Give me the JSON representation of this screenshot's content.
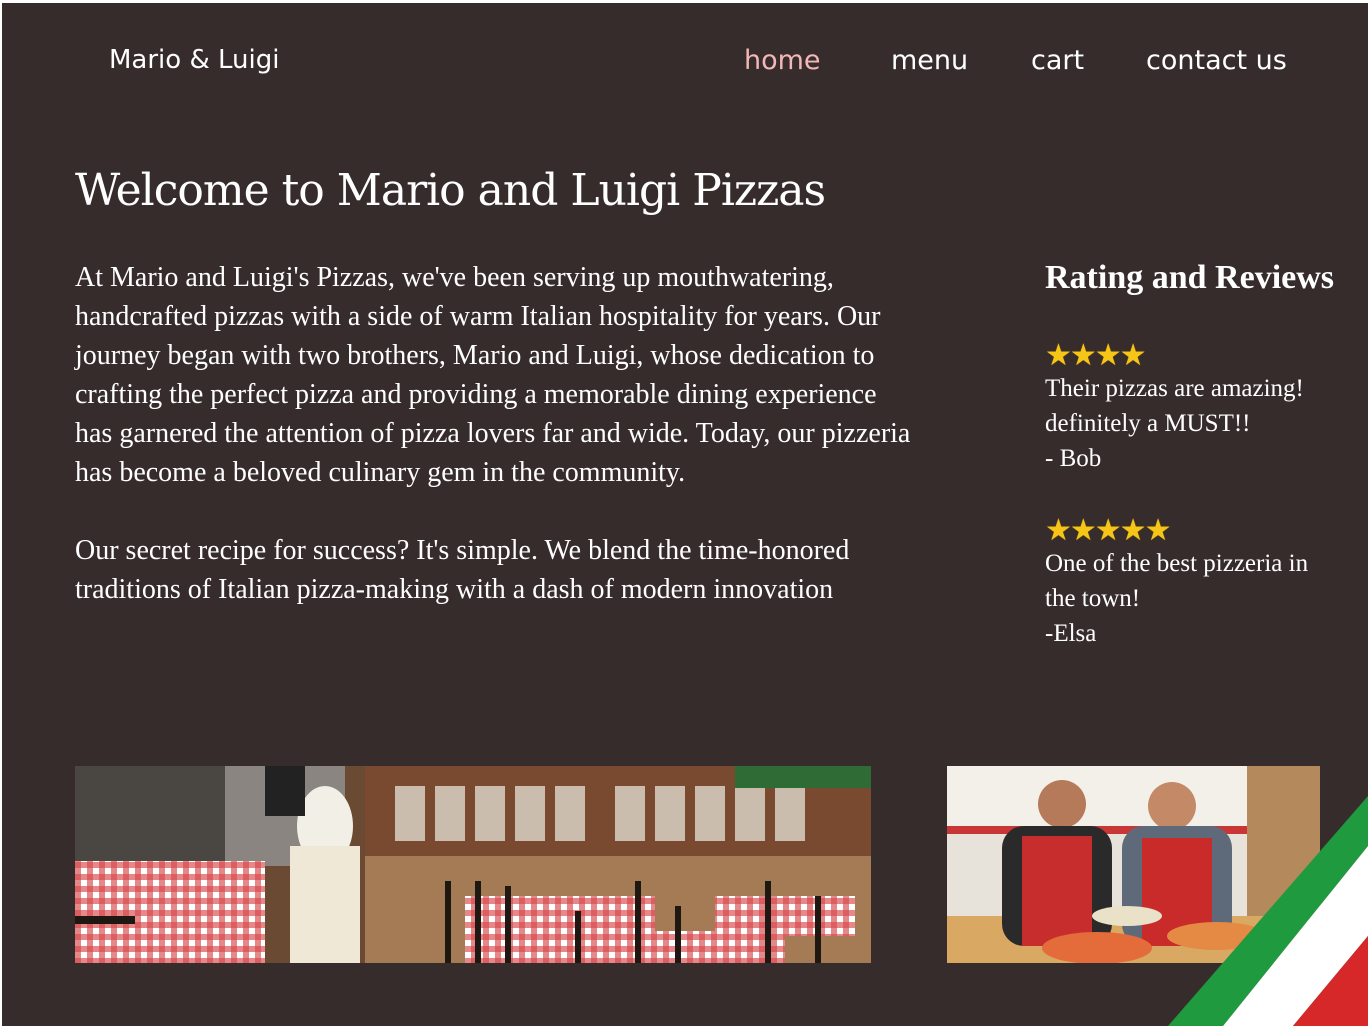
{
  "brand": "Mario & Luigi",
  "nav": {
    "home": "home",
    "menu": "menu",
    "cart": "cart",
    "contact": "contact us"
  },
  "title": "Welcome to Mario and Luigi Pizzas",
  "intro": {
    "p1": "At Mario and Luigi's Pizzas, we've been serving up mouthwatering, handcrafted pizzas with a side of warm Italian hospitality for years. Our journey began with two brothers, Mario and Luigi, whose dedication to crafting the perfect pizza and providing a memorable dining experience has garnered the attention of pizza lovers far and wide. Today, our pizzeria has become a beloved culinary gem in the community.",
    "p2": "Our secret recipe for success? It's simple. We blend the time-honored traditions of Italian pizza-making with a dash of modern innovation"
  },
  "reviews": {
    "title": "Rating and Reviews",
    "items": [
      {
        "rating": 4,
        "stars": "★★★★",
        "text": "Their pizzas are amazing! definitely a MUST!!",
        "author": "- Bob"
      },
      {
        "rating": 5,
        "stars": "★★★★★",
        "text": "One of the best pizzeria in the town!",
        "author": "-Elsa"
      }
    ]
  },
  "colors": {
    "background": "#372c2c",
    "nav_active": "#f2b8b8",
    "text": "#ffffff",
    "flag_green": "#1f9a3e",
    "flag_white": "#ffffff",
    "flag_red": "#d62828"
  },
  "images": {
    "interior": "restaurant-interior-photo",
    "chefs": "chefs-with-pizzas-photo"
  }
}
